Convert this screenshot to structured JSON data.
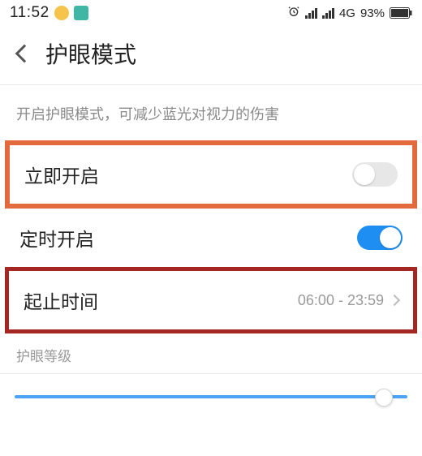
{
  "status": {
    "time": "11:52",
    "network": "4G",
    "battery_pct": "93%"
  },
  "header": {
    "title": "护眼模式"
  },
  "description": "开启护眼模式，可减少蓝光对视力的伤害",
  "rows": {
    "enable_now": {
      "label": "立即开启",
      "on": false
    },
    "schedule": {
      "label": "定时开启",
      "on": true
    },
    "time_range": {
      "label": "起止时间",
      "value": "06:00 - 23:59"
    }
  },
  "level_section": {
    "label": "护眼等级",
    "slider_pct": 96
  }
}
